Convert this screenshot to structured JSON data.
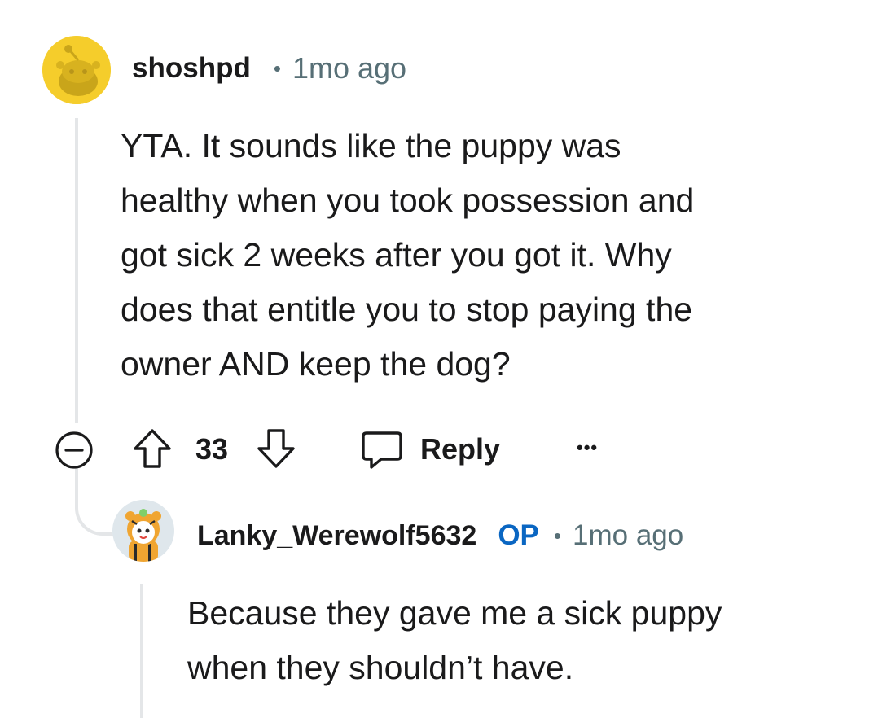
{
  "comment": {
    "author": "shoshpd",
    "separator": "•",
    "time": "1mo ago",
    "body": [
      "YTA. It sounds like the puppy was",
      "healthy when you took possession and",
      "got sick 2 weeks after you got it. Why",
      "does that entitle you to stop paying the",
      "owner AND keep the dog?"
    ],
    "actions": {
      "collapse_icon": "minus-circle-icon",
      "upvote_icon": "arrow-up-icon",
      "score": "33",
      "downvote_icon": "arrow-down-icon",
      "reply_icon": "speech-bubble-icon",
      "reply_label": "Reply",
      "more_icon": "ellipsis-icon",
      "more_label": "•••"
    },
    "avatar_color": "#f5cd2b"
  },
  "reply": {
    "author": "Lanky_Werewolf5632",
    "op_badge": "OP",
    "separator": "•",
    "time": "1mo ago",
    "body": [
      "Because they gave me a sick puppy",
      "when they shouldn’t have."
    ]
  },
  "colors": {
    "thread_line": "#e4e6e8",
    "meta_gray": "#576f76",
    "op_blue": "#0a66c2"
  }
}
